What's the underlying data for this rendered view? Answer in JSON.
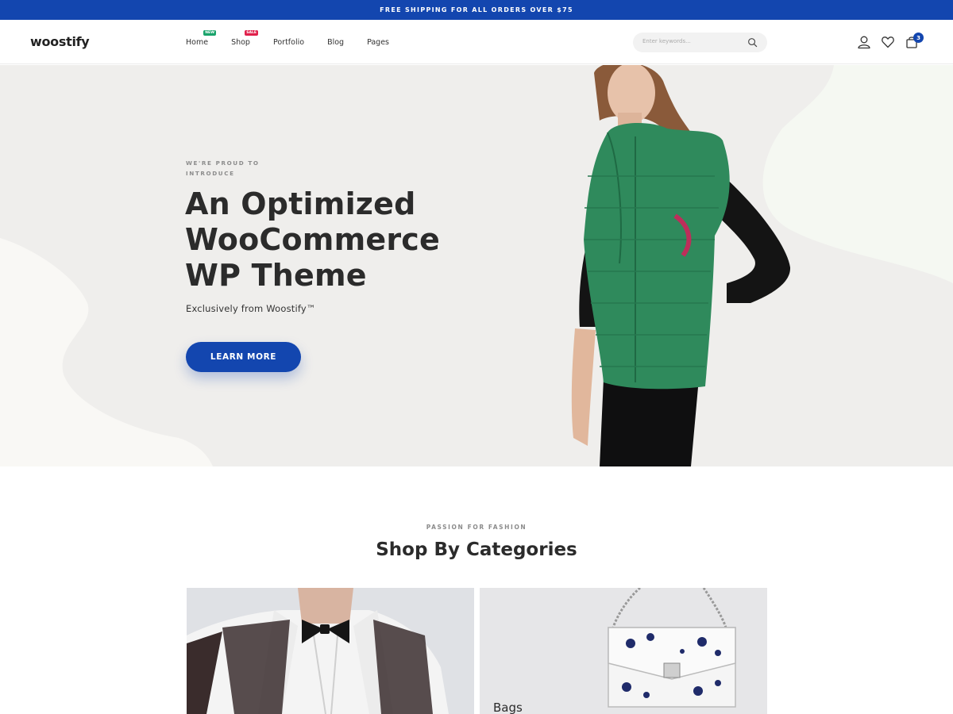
{
  "announcement": "FREE SHIPPING FOR ALL ORDERS OVER $75",
  "logo": "woostify",
  "nav": {
    "items": [
      {
        "label": "Home",
        "badge": "NEW"
      },
      {
        "label": "Shop",
        "badge": "SALE"
      },
      {
        "label": "Portfolio"
      },
      {
        "label": "Blog"
      },
      {
        "label": "Pages"
      }
    ]
  },
  "search": {
    "placeholder": "Enter keywords..."
  },
  "cart": {
    "count": "3"
  },
  "hero": {
    "eyebrow": "WE'RE PROUD TO INTRODUCE",
    "title": "An Optimized WooCommerce WP Theme",
    "subtitle": "Exclusively from Woostify™",
    "cta": "LEARN MORE"
  },
  "categories": {
    "eyebrow": "PASSION FOR FASHION",
    "title": "Shop By Categories",
    "cards": [
      {
        "label": ""
      },
      {
        "label": "Bags"
      }
    ]
  },
  "colors": {
    "accent": "#1346af",
    "new_badge": "#1aa36b",
    "sale_badge": "#e0204b",
    "hero_bg": "#efeeec"
  }
}
